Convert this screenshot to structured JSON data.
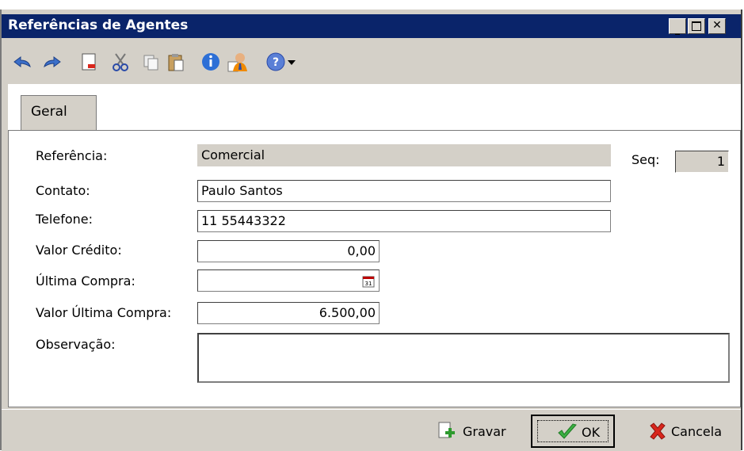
{
  "window": {
    "title": "Referências de Agentes",
    "controls": [
      "_",
      "□",
      "X"
    ]
  },
  "toolbar": {
    "icons": [
      "undo-icon",
      "redo-icon",
      "new-document-icon",
      "cut-icon",
      "copy-icon",
      "paste-icon",
      "info-icon",
      "user-icon",
      "help-icon",
      "dropdown-arrow-icon"
    ]
  },
  "tabs": [
    {
      "label": "Geral"
    }
  ],
  "form": {
    "referencia_label": "Referência:",
    "referencia_value": "Comercial",
    "seq_label": "Seq:",
    "seq_value": "1",
    "contato_label": "Contato:",
    "contato_value": "Paulo Santos",
    "telefone_label": "Telefone:",
    "telefone_value": "11 55443322",
    "valor_credito_label": "Valor Crédito:",
    "valor_credito_value": "0,00",
    "ultima_compra_label": "Última Compra:",
    "ultima_compra_value": "",
    "valor_ultima_compra_label": "Valor Última Compra:",
    "valor_ultima_compra_value": "6.500,00",
    "observacao_label": "Observação:",
    "observacao_value": ""
  },
  "footer": {
    "gravar_label": "Gravar",
    "ok_label": "OK",
    "cancela_label": "Cancela"
  },
  "colors": {
    "titlebar": "#0a246a",
    "face": "#d4d0c8",
    "ok_green": "#3cb043",
    "cancel_red": "#d9261c"
  }
}
